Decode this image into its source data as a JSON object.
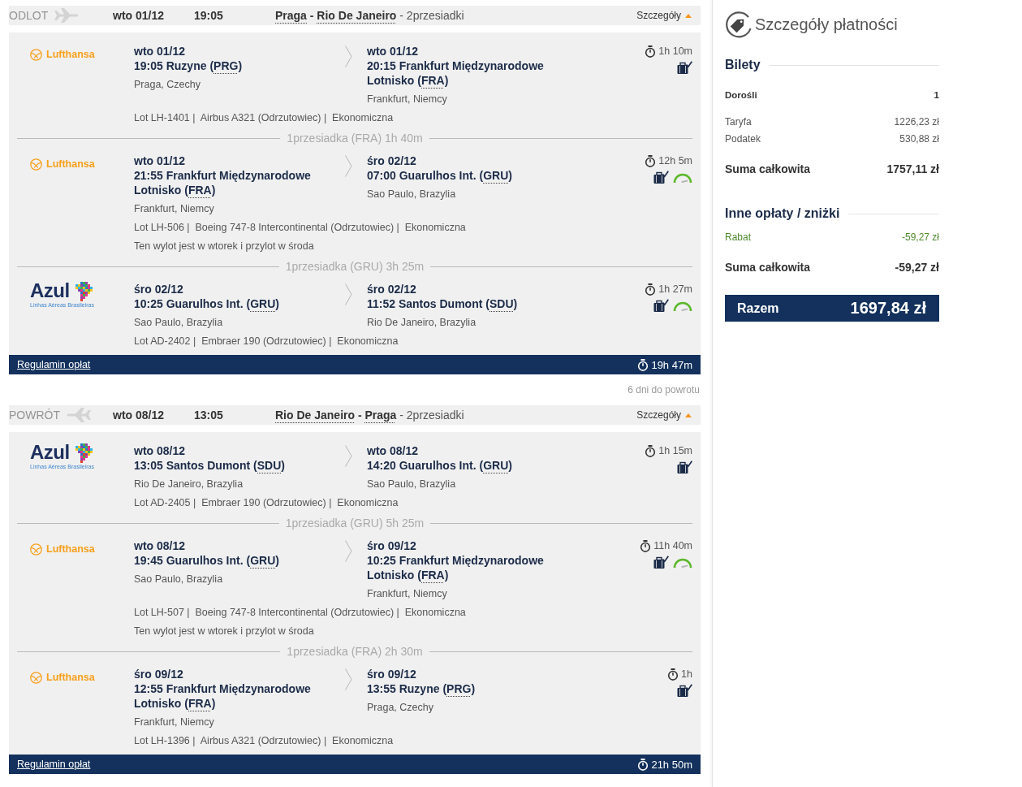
{
  "outbound": {
    "label": "ODLOT",
    "plane_reversed": false,
    "date": "wto 01/12",
    "time": "19:05",
    "from": "Praga",
    "to": "- Rio De Janeiro",
    "stops": "- 2przesiadki",
    "details": {
      "label": "Szczegóły",
      "expanded": true
    },
    "legs": [
      {
        "kind": "segment",
        "airline": {
          "kind": "lufthansa",
          "name": "Lufthansa"
        },
        "depart": {
          "date": "wto 01/12",
          "place": "19:05 Ruzyne",
          "code": "(PRG)",
          "city": "Praga, Czechy"
        },
        "arrive": {
          "date": "wto 01/12",
          "place": "20:15 Frankfurt Międzynarodowe Lotnisko",
          "code": "(FRA)",
          "city": "Frankfurt, Niemcy"
        },
        "duration": "1h 10m",
        "gauge": false,
        "info": "Lot LH-1401 |  Airbus A321 (Odrzutowiec) |  Ekonomiczna"
      },
      {
        "kind": "layover",
        "text": "1przesiadka (FRA) 1h 40m"
      },
      {
        "kind": "segment",
        "airline": {
          "kind": "lufthansa",
          "name": "Lufthansa"
        },
        "depart": {
          "date": "wto 01/12",
          "place": "21:55 Frankfurt Międzynarodowe Lotnisko",
          "code": "(FRA)",
          "city": "Frankfurt, Niemcy"
        },
        "arrive": {
          "date": "śro 02/12",
          "place": "07:00 Guarulhos Int.",
          "code": "(GRU)",
          "city": "Sao Paulo, Brazylia"
        },
        "duration": "12h 5m",
        "gauge": true,
        "info": "Lot LH-506 |  Boeing 747-8 Intercontinental (Odrzutowiec) |  Ekonomiczna",
        "note": "Ten wylot jest w wtorek i przylot w środa"
      },
      {
        "kind": "layover",
        "text": "1przesiadka (GRU) 3h 25m"
      },
      {
        "kind": "segment",
        "airline": {
          "kind": "azul",
          "name": "Azul",
          "tagline": "Linhas Aéreas Brasileiras"
        },
        "depart": {
          "date": "śro 02/12",
          "place": "10:25 Guarulhos Int.",
          "code": "(GRU)",
          "city": "Sao Paulo, Brazylia"
        },
        "arrive": {
          "date": "śro 02/12",
          "place": "11:52 Santos Dumont",
          "code": "(SDU)",
          "city": "Rio De Janeiro, Brazylia"
        },
        "duration": "1h 27m",
        "gauge": true,
        "info": "Lot AD-2402 |  Embraer 190 (Odrzutowiec) |  Ekonomiczna"
      }
    ],
    "footer": {
      "link": "Regulamin opłat",
      "total_duration": "19h 47m"
    }
  },
  "days_to_return": "6 dni do powrotu",
  "return": {
    "label": "POWRÓT",
    "plane_reversed": true,
    "date": "wto 08/12",
    "time": "13:05",
    "from": "Rio De Janeiro",
    "to": "- Praga",
    "stops": "- 2przesiadki",
    "details": {
      "label": "Szczegóły",
      "expanded": true
    },
    "legs": [
      {
        "kind": "segment",
        "airline": {
          "kind": "azul",
          "name": "Azul",
          "tagline": "Linhas Aéreas Brasileiras"
        },
        "depart": {
          "date": "wto 08/12",
          "place": "13:05 Santos Dumont",
          "code": "(SDU)",
          "city": "Rio De Janeiro, Brazylia"
        },
        "arrive": {
          "date": "wto 08/12",
          "place": "14:20 Guarulhos Int.",
          "code": "(GRU)",
          "city": "Sao Paulo, Brazylia"
        },
        "duration": "1h 15m",
        "gauge": false,
        "info": "Lot AD-2405 |  Embraer 190 (Odrzutowiec) |  Ekonomiczna"
      },
      {
        "kind": "layover",
        "text": "1przesiadka (GRU) 5h 25m"
      },
      {
        "kind": "segment",
        "airline": {
          "kind": "lufthansa",
          "name": "Lufthansa"
        },
        "depart": {
          "date": "wto 08/12",
          "place": "19:45 Guarulhos Int.",
          "code": "(GRU)",
          "city": "Sao Paulo, Brazylia"
        },
        "arrive": {
          "date": "śro 09/12",
          "place": "10:25 Frankfurt Międzynarodowe Lotnisko",
          "code": "(FRA)",
          "city": "Frankfurt, Niemcy"
        },
        "duration": "11h 40m",
        "gauge": true,
        "info": "Lot LH-507 |  Boeing 747-8 Intercontinental (Odrzutowiec) |  Ekonomiczna",
        "note": "Ten wylot jest w wtorek i przylot w środa"
      },
      {
        "kind": "layover",
        "text": "1przesiadka (FRA) 2h 30m"
      },
      {
        "kind": "segment",
        "airline": {
          "kind": "lufthansa",
          "name": "Lufthansa"
        },
        "depart": {
          "date": "śro 09/12",
          "place": "12:55 Frankfurt Międzynarodowe Lotnisko",
          "code": "(FRA)",
          "city": "Frankfurt, Niemcy"
        },
        "arrive": {
          "date": "śro 09/12",
          "place": "13:55 Ruzyne",
          "code": "(PRG)",
          "city": "Praga, Czechy"
        },
        "duration": "1h",
        "gauge": false,
        "info": "Lot LH-1396 |  Airbus A321 (Odrzutowiec) |  Ekonomiczna"
      }
    ],
    "footer": {
      "link": "Regulamin opłat",
      "total_duration": "21h 50m"
    }
  },
  "payment": {
    "title": "Szczegóły płatności",
    "sections": [
      {
        "heading": "Bilety",
        "rows": [
          {
            "kind": "passengers",
            "label": "Dorośli",
            "value": "1"
          },
          {
            "kind": "line",
            "label": "Taryfa",
            "value": "1226,23 zł"
          },
          {
            "kind": "line",
            "label": "Podatek",
            "value": "530,88 zł"
          },
          {
            "kind": "total",
            "label": "Suma całkowita",
            "value": "1757,11 zł"
          }
        ]
      },
      {
        "heading": "Inne opłaty / zniżki",
        "rows": [
          {
            "kind": "discount",
            "label": "Rabat",
            "value": "-59,27 zł"
          },
          {
            "kind": "total",
            "label": "Suma całkowita",
            "value": "-59,27 zł"
          }
        ]
      }
    ],
    "grand_total": {
      "label": "Razem",
      "value": "1697,84 zł"
    }
  }
}
